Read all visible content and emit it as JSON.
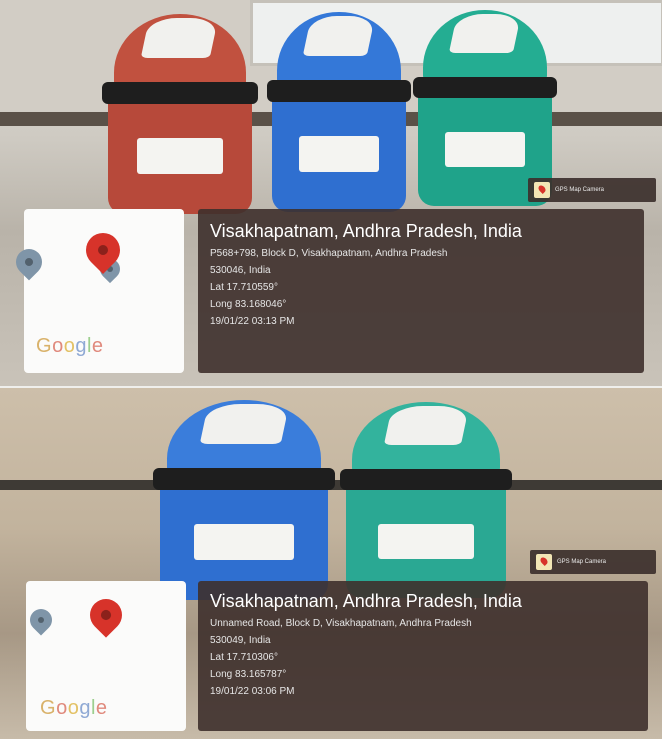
{
  "photos": [
    {
      "stamp_label": "GPS Map Camera",
      "map_logo": "Google",
      "title": "Visakhapatnam, Andhra Pradesh, India",
      "address_line": "P568+798, Block D, Visakhapatnam, Andhra Pradesh",
      "postal_line": "530046, India",
      "lat": "Lat 17.710559°",
      "long": "Long 83.168046°",
      "datetime": "19/01/22 03:13 PM",
      "bin_colors": [
        "#b7493a",
        "#2f6fd0",
        "#1fa38a"
      ]
    },
    {
      "stamp_label": "GPS Map Camera",
      "map_logo": "Google",
      "title": "Visakhapatnam, Andhra Pradesh, India",
      "address_line": "Unnamed Road, Block D, Visakhapatnam, Andhra Pradesh",
      "postal_line": "530049, India",
      "lat": "Lat 17.710306°",
      "long": "Long 83.165787°",
      "datetime": "19/01/22 03:06 PM",
      "bin_colors": [
        "#2f6fd0",
        "#2aa893"
      ]
    }
  ],
  "colors": {
    "pin_red": "#d7332a",
    "pin_grey": "#7f95a8",
    "overlay": "#3e302c"
  }
}
